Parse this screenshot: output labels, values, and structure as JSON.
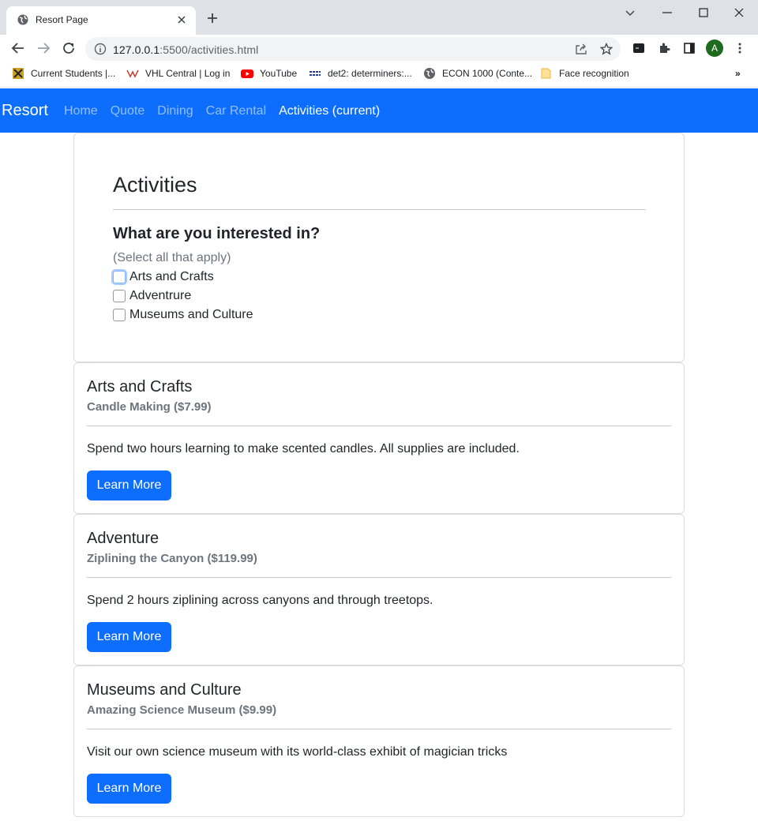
{
  "browser": {
    "tab_title": "Resort Page",
    "url_host": "127.0.0.1",
    "url_rest": ":5500/activities.html",
    "profile_initial": "A",
    "bookmarks": [
      "Current Students |...",
      "VHL Central | Log in",
      "YouTube",
      "det2: determiners:...",
      "ECON 1000 (Conte...",
      "Face recognition"
    ],
    "more_bookmarks": "»"
  },
  "navbar": {
    "brand": "Resort",
    "links": [
      "Home",
      "Quote",
      "Dining",
      "Car Rental",
      "Activities (current)"
    ]
  },
  "intro": {
    "title": "Activities",
    "question": "What are you interested in?",
    "hint": "(Select all that apply)",
    "options": [
      "Arts and Crafts",
      "Adventrure",
      "Museums and Culture"
    ]
  },
  "activities": [
    {
      "title": "Arts and Crafts",
      "subtitle": "Candle Making ($7.99)",
      "text": "Spend two hours learning to make scented candles. All supplies are included.",
      "button": "Learn More"
    },
    {
      "title": "Adventure",
      "subtitle": "Ziplining the Canyon ($119.99)",
      "text": "Spend 2 hours ziplining across canyons and through treetops.",
      "button": "Learn More"
    },
    {
      "title": "Museums and Culture",
      "subtitle": "Amazing Science Museum ($9.99)",
      "text": "Visit our own science museum with its world-class exhibit of magician tricks",
      "button": "Learn More"
    }
  ],
  "colors": {
    "primary": "#0d6efd",
    "muted": "#6c757d"
  }
}
